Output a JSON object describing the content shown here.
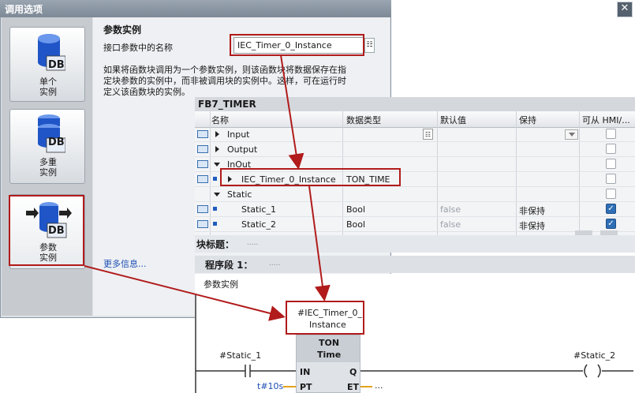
{
  "dialog": {
    "title": "调用选项",
    "close_glyph": "✕",
    "options": [
      {
        "label_line1": "单个",
        "label_line2": "实例",
        "icon_text": "DB"
      },
      {
        "label_line1": "多重",
        "label_line2": "实例",
        "icon_text": "DB"
      },
      {
        "label_line1": "参数",
        "label_line2": "实例",
        "icon_text": "DB"
      }
    ],
    "heading": "参数实例",
    "field_label": "接口参数中的名称",
    "field_value": "IEC_Timer_0_Instance",
    "description_line1": "如果将函数块调用为一个参数实例，则该函数块将数据保存在指",
    "description_line2": "定块参数的实例中，而非被调用块的实例中。这样，可在运行时",
    "description_line3": "定义该函数块的实例。",
    "more_info": "更多信息..."
  },
  "interface": {
    "title": "FB7_TIMER",
    "columns": [
      "名称",
      "数据类型",
      "默认值",
      "保持",
      "可从 HMI/..."
    ],
    "rows": [
      {
        "name": "Input",
        "type": "",
        "default": "",
        "retain": "",
        "hmi": false
      },
      {
        "name": "Output",
        "type": "",
        "default": "",
        "retain": "",
        "hmi": false
      },
      {
        "name": "InOut",
        "type": "",
        "default": "",
        "retain": "",
        "hmi": false
      },
      {
        "name": "IEC_Timer_0_Instance",
        "type": "TON_TIME",
        "default": "",
        "retain": "",
        "hmi": false
      },
      {
        "name": "Static",
        "type": "",
        "default": "",
        "retain": "",
        "hmi": false
      },
      {
        "name": "Static_1",
        "type": "Bool",
        "default": "false",
        "retain": "非保持",
        "hmi": true
      },
      {
        "name": "Static_2",
        "type": "Bool",
        "default": "false",
        "retain": "非保持",
        "hmi": true
      }
    ]
  },
  "block": {
    "title_label": "块标题：",
    "title_value": ".....",
    "network_label": "程序段 1：",
    "network_value": ".....",
    "network_comment": "参数实例"
  },
  "ladder": {
    "instance_line1": "#IEC_Timer_0_",
    "instance_line2": "Instance",
    "box_type": "TON",
    "box_subtype": "Time",
    "pin_in": "IN",
    "pin_q": "Q",
    "pin_pt": "PT",
    "pin_et": "ET",
    "contact_label": "#Static_1",
    "coil_label": "#Static_2",
    "pt_value": "t#10s",
    "et_value": "..."
  },
  "colors": {
    "highlight": "#b11b1b",
    "checkbox_on": "#2f6fb5",
    "db_icon": "#1f55c7"
  }
}
